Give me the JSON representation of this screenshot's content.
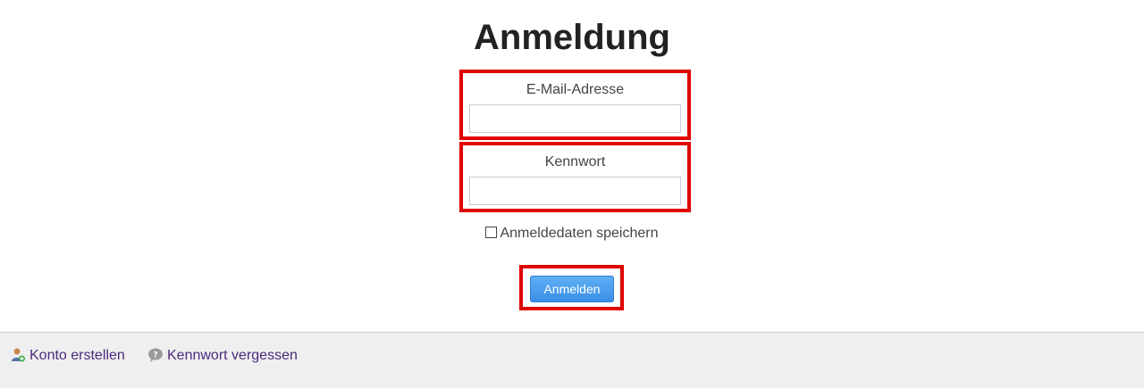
{
  "page": {
    "title": "Anmeldung"
  },
  "form": {
    "email": {
      "label": "E-Mail-Adresse",
      "value": "",
      "placeholder": ""
    },
    "password": {
      "label": "Kennwort",
      "value": "",
      "placeholder": ""
    },
    "remember": {
      "label": "Anmeldedaten speichern",
      "checked": false
    },
    "submit_label": "Anmelden"
  },
  "footer": {
    "links": [
      {
        "label": "Konto erstellen",
        "icon": "user-add-icon"
      },
      {
        "label": "Kennwort vergessen",
        "icon": "help-bubble-icon"
      }
    ]
  },
  "colors": {
    "highlight_border": "#e00000",
    "button": "#3a8ee6",
    "link": "#4b2a7a",
    "footer_bg": "#efefef"
  }
}
